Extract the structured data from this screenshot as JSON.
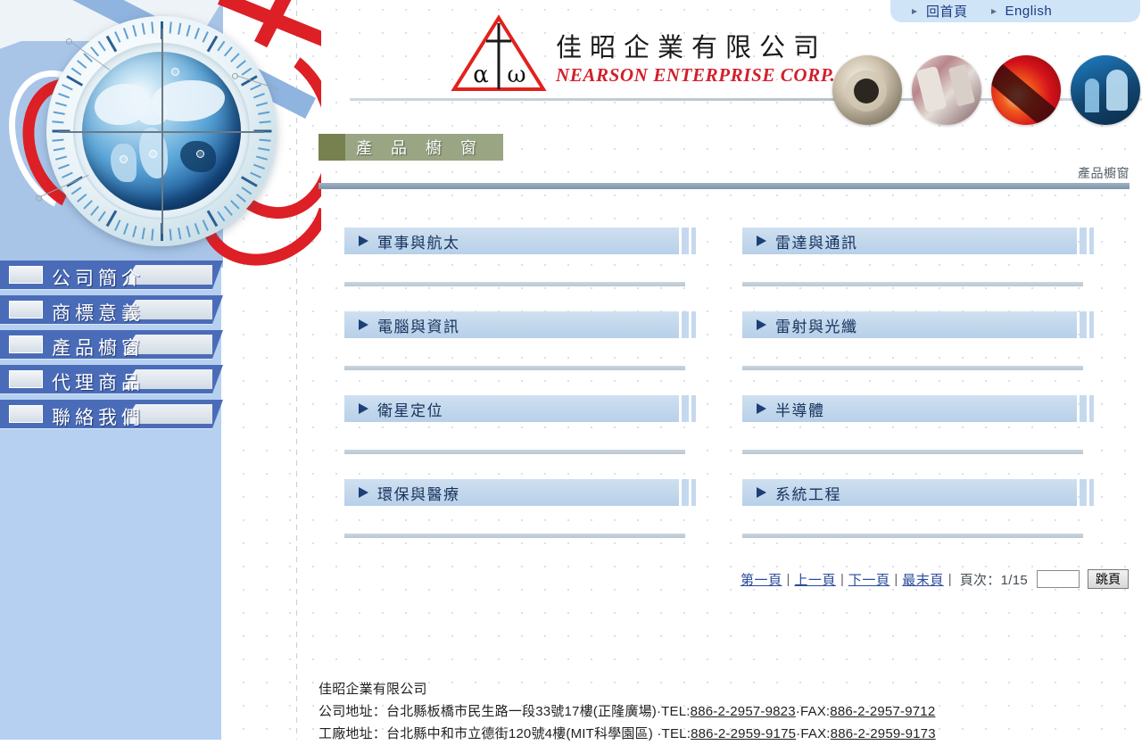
{
  "topnav": {
    "items": [
      {
        "label": "回首頁",
        "icon": "arrow-bullet-icon"
      },
      {
        "label": "English",
        "icon": "arrow-bullet-icon"
      }
    ]
  },
  "brand": {
    "logo_icon": "triangle-alpha-omega-logo",
    "name_cn": "佳昭企業有限公司",
    "name_en": "NEARSON ENTERPRISE CORP."
  },
  "header_thumbs": [
    {
      "name": "metal-component-photo"
    },
    {
      "name": "mobile-phones-photo"
    },
    {
      "name": "red-laser-photo"
    },
    {
      "name": "cleanroom-worker-photo"
    }
  ],
  "sidebar": {
    "items": [
      {
        "label": "公司簡介"
      },
      {
        "label": "商標意義"
      },
      {
        "label": "產品櫥窗"
      },
      {
        "label": "代理商品"
      },
      {
        "label": "聯絡我們"
      }
    ]
  },
  "page": {
    "title": "產 品 櫥 窗",
    "breadcrumb": "產品櫥窗"
  },
  "categories": [
    {
      "label": "軍事與航太"
    },
    {
      "label": "雷達與通訊"
    },
    {
      "label": "電腦與資訊"
    },
    {
      "label": "雷射與光纖"
    },
    {
      "label": "衛星定位"
    },
    {
      "label": "半導體"
    },
    {
      "label": "環保與醫療"
    },
    {
      "label": "系統工程"
    }
  ],
  "pager": {
    "first": "第一頁",
    "prev": "上一頁",
    "next": "下一頁",
    "last": "最末頁",
    "info": "頁次：1/15",
    "page_input_value": "",
    "go_label": "跳頁",
    "current_page": 1,
    "total_pages": 15
  },
  "footer": {
    "company": "佳昭企業有限公司",
    "office_label": "公司地址：",
    "office_address": "台北縣板橋市民生路一段33號17樓(正隆廣場)",
    "office_tel_label": "·TEL:",
    "office_tel": "886-2-2957-9823",
    "office_fax_label": "·FAX:",
    "office_fax": "886-2-2957-9712",
    "factory_label": "工廠地址：",
    "factory_address": "台北縣中和市立德街120號4樓(MIT科學園區)",
    "factory_tel_label": " ·TEL:",
    "factory_tel": "886-2-2959-9175",
    "factory_fax_label": "·FAX:",
    "factory_fax": "886-2-2959-9173"
  },
  "colors": {
    "nav_blue": "#4a6cb8",
    "sidebar_bg": "#b5d0f0",
    "title_olive": "#9aa584",
    "title_olive_dark": "#76814f",
    "button_blue": "#c2d7ec",
    "brand_red": "#d31f2b",
    "link_blue": "#2a4b9b"
  }
}
